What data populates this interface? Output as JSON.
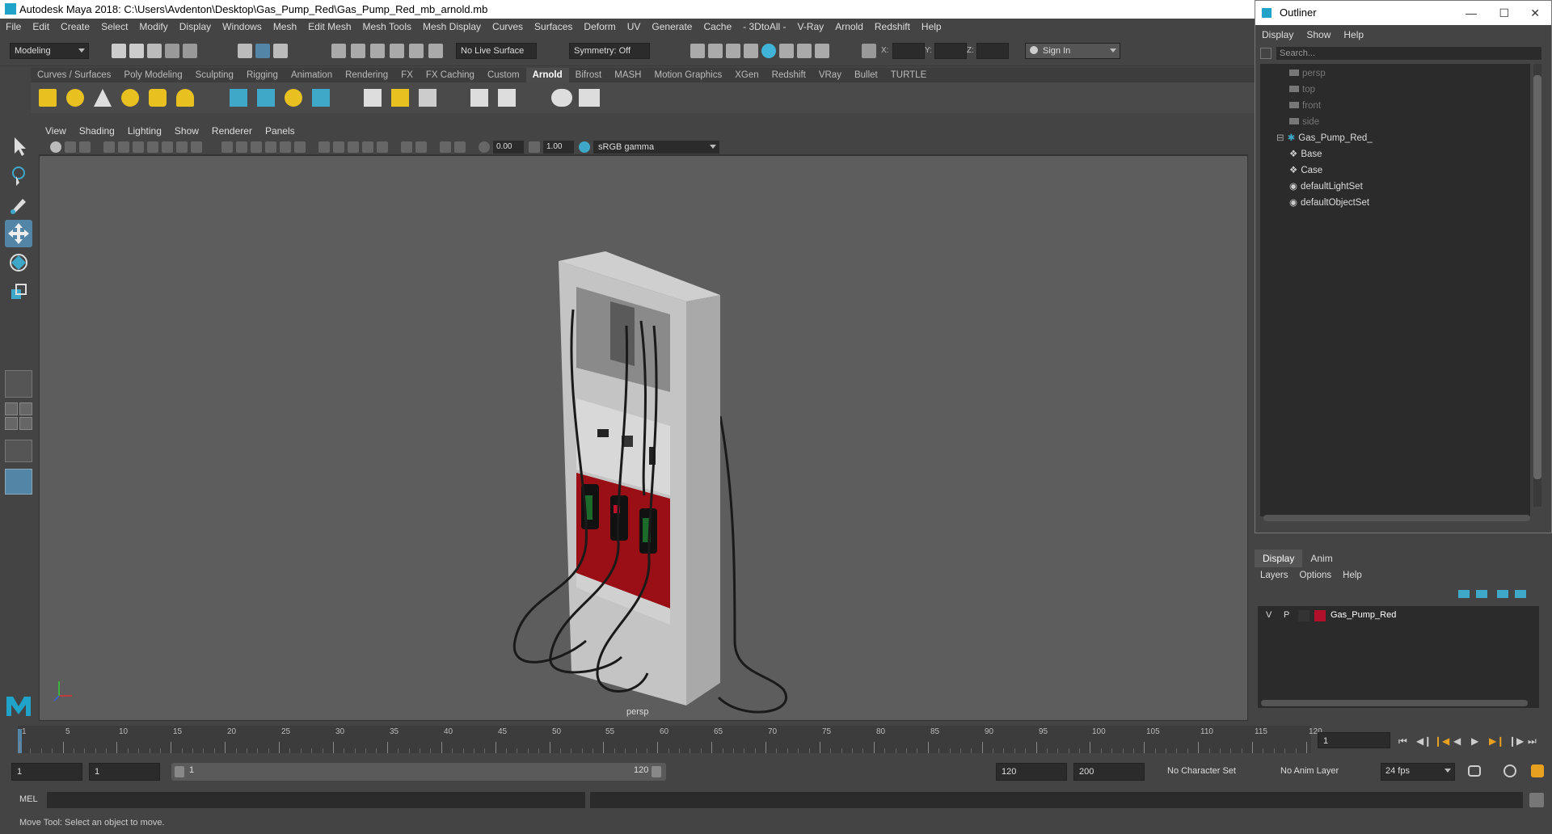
{
  "window_title": "Autodesk Maya 2018: C:\\Users\\Avdenton\\Desktop\\Gas_Pump_Red\\Gas_Pump_Red_mb_arnold.mb",
  "menubar": [
    "File",
    "Edit",
    "Create",
    "Select",
    "Modify",
    "Display",
    "Windows",
    "Mesh",
    "Edit Mesh",
    "Mesh Tools",
    "Mesh Display",
    "Curves",
    "Surfaces",
    "Deform",
    "UV",
    "Generate",
    "Cache",
    "- 3DtoAll -",
    "V-Ray",
    "Arnold",
    "Redshift",
    "Help"
  ],
  "status": {
    "mode": "Modeling",
    "live_surface": "No Live Surface",
    "symmetry": "Symmetry: Off",
    "x_label": "X:",
    "y_label": "Y:",
    "z_label": "Z:",
    "sign_in": "Sign In"
  },
  "shelf_tabs": [
    "Curves / Surfaces",
    "Poly Modeling",
    "Sculpting",
    "Rigging",
    "Animation",
    "Rendering",
    "FX",
    "FX Caching",
    "Custom",
    "Arnold",
    "Bifrost",
    "MASH",
    "Motion Graphics",
    "XGen",
    "Redshift",
    "VRay",
    "Bullet",
    "TURTLE"
  ],
  "shelf_active": "Arnold",
  "panel_menu": [
    "View",
    "Shading",
    "Lighting",
    "Show",
    "Renderer",
    "Panels"
  ],
  "panel_toolbar": {
    "exposure": "0.00",
    "gamma": "1.00",
    "color_space": "sRGB gamma"
  },
  "viewport": {
    "camera_label": "persp"
  },
  "outliner": {
    "title": "Outliner",
    "menu": [
      "Display",
      "Show",
      "Help"
    ],
    "search_placeholder": "Search...",
    "items": [
      {
        "label": "persp",
        "dim": true
      },
      {
        "label": "top",
        "dim": true
      },
      {
        "label": "front",
        "dim": true
      },
      {
        "label": "side",
        "dim": true
      },
      {
        "label": "Gas_Pump_Red_",
        "dim": false
      },
      {
        "label": "Base",
        "dim": false
      },
      {
        "label": "Case",
        "dim": false
      },
      {
        "label": "defaultLightSet",
        "dim": false
      },
      {
        "label": "defaultObjectSet",
        "dim": false
      }
    ]
  },
  "layers": {
    "tabs": [
      "Display",
      "Anim"
    ],
    "menu": [
      "Layers",
      "Options",
      "Help"
    ],
    "layer": {
      "v": "V",
      "p": "P",
      "name": "Gas_Pump_Red",
      "color": "#b0102a"
    }
  },
  "timeline": {
    "ticks": [
      "1",
      "5",
      "10",
      "15",
      "20",
      "25",
      "30",
      "35",
      "40",
      "45",
      "50",
      "55",
      "60",
      "65",
      "70",
      "75",
      "80",
      "85",
      "90",
      "95",
      "100",
      "105",
      "110",
      "115",
      "120"
    ],
    "current_frame": "1"
  },
  "range": {
    "start": "1",
    "playback_start": "1",
    "slider_start": "1",
    "slider_end": "120",
    "playback_end": "120",
    "end": "200",
    "character_set": "No Character Set",
    "anim_layer": "No Anim Layer",
    "fps": "24 fps"
  },
  "command": {
    "label": "MEL"
  },
  "help_line": "Move Tool: Select an object to move.",
  "colors": {
    "accent": "#5285a6",
    "pump_red": "#9a0f15"
  }
}
